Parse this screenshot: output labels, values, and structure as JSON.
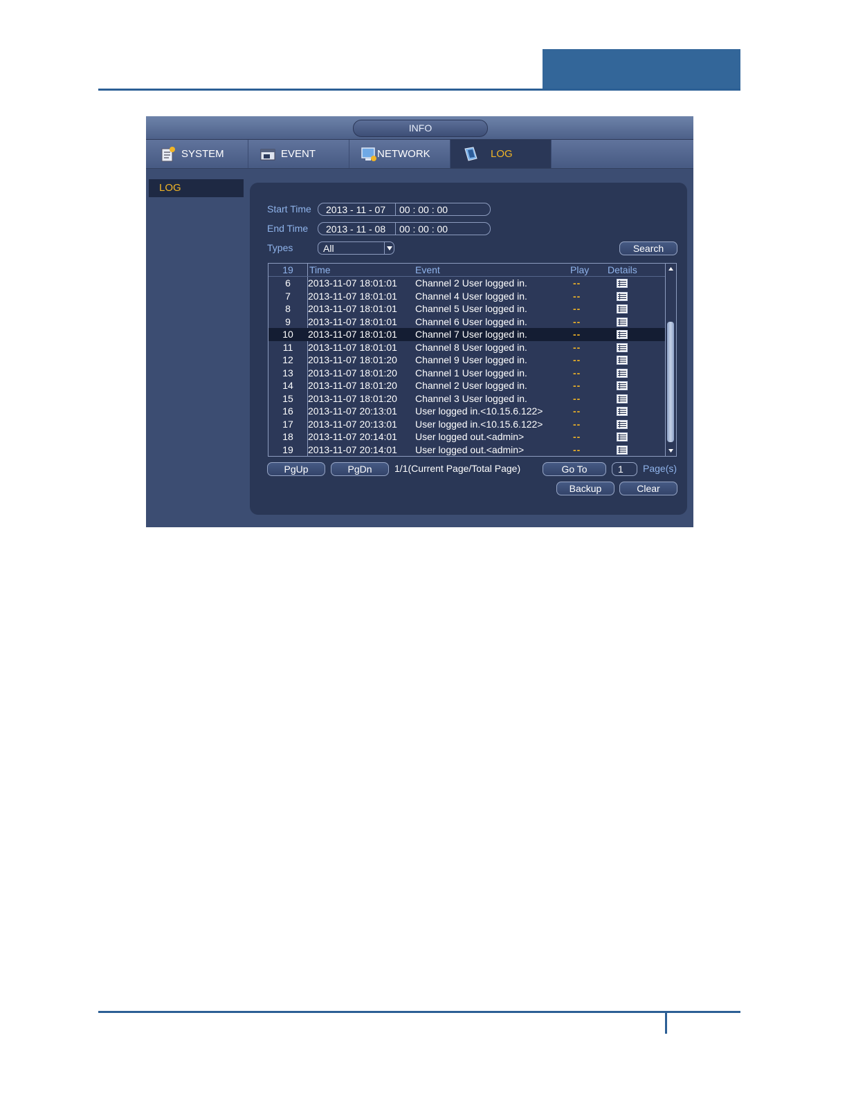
{
  "window": {
    "title": "INFO",
    "tabs": [
      {
        "label": "SYSTEM",
        "icon": "system-icon"
      },
      {
        "label": "EVENT",
        "icon": "event-icon"
      },
      {
        "label": "NETWORK",
        "icon": "network-icon"
      },
      {
        "label": "LOG",
        "icon": "log-icon",
        "active": true
      }
    ],
    "left_nav": [
      "LOG"
    ]
  },
  "filters": {
    "start_label": "Start Time",
    "start_date": "2013 - 11 - 07",
    "start_time": "00 :  00 :  00",
    "end_label": "End Time",
    "end_date": "2013 - 11 - 08",
    "end_time": "00 :  00 :  00",
    "types_label": "Types",
    "types_value": "All",
    "search_label": "Search"
  },
  "table": {
    "count": "19",
    "headers": {
      "time": "Time",
      "event": "Event",
      "play": "Play",
      "details": "Details"
    },
    "rows": [
      {
        "idx": "6",
        "time": "2013-11-07 18:01:01",
        "event": "Channel 2   User logged in.",
        "play": "--"
      },
      {
        "idx": "7",
        "time": "2013-11-07 18:01:01",
        "event": "Channel 4  User logged in.",
        "play": "--"
      },
      {
        "idx": "8",
        "time": "2013-11-07 18:01:01",
        "event": "Channel 5  User logged in.",
        "play": "--"
      },
      {
        "idx": "9",
        "time": "2013-11-07 18:01:01",
        "event": "Channel 6  User logged in.",
        "play": "--"
      },
      {
        "idx": "10",
        "time": "2013-11-07 18:01:01",
        "event": "Channel 7  User logged in.",
        "play": "--",
        "selected": true
      },
      {
        "idx": "11",
        "time": "2013-11-07 18:01:01",
        "event": "Channel 8  User logged in.",
        "play": "--"
      },
      {
        "idx": "12",
        "time": "2013-11-07 18:01:20",
        "event": "Channel 9  User logged in.",
        "play": "--"
      },
      {
        "idx": "13",
        "time": "2013-11-07 18:01:20",
        "event": "Channel 1   User logged in.",
        "play": "--"
      },
      {
        "idx": "14",
        "time": "2013-11-07 18:01:20",
        "event": "Channel 2  User logged in.",
        "play": "--"
      },
      {
        "idx": "15",
        "time": "2013-11-07 18:01:20",
        "event": "Channel 3  User logged in.",
        "play": "--"
      },
      {
        "idx": "16",
        "time": "2013-11-07 20:13:01",
        "event": "User logged in.<10.15.6.122>",
        "play": "--"
      },
      {
        "idx": "17",
        "time": "2013-11-07 20:13:01",
        "event": "User logged in.<10.15.6.122>",
        "play": "--"
      },
      {
        "idx": "18",
        "time": "2013-11-07 20:14:01",
        "event": "User logged out.<admin>",
        "play": "--"
      },
      {
        "idx": "19",
        "time": "2013-11-07 20:14:01",
        "event": "User logged out.<admin>",
        "play": "--"
      }
    ]
  },
  "pager": {
    "pgup": "PgUp",
    "pgdn": "PgDn",
    "info": "1/1(Current Page/Total Page)",
    "goto": "Go To",
    "page_value": "1",
    "pages_label": "Page(s)"
  },
  "actions": {
    "backup": "Backup",
    "clear": "Clear"
  },
  "colors": {
    "accent": "#f1b526",
    "label": "#8fb3ea",
    "panel": "#2a3756",
    "header_band": "#336699"
  }
}
